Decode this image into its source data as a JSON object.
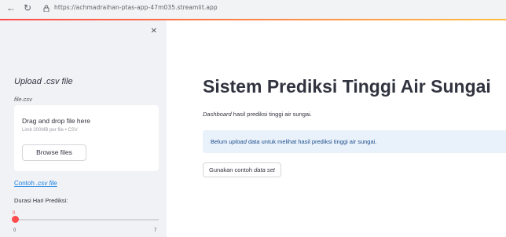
{
  "browser": {
    "url": "https://achmadraihan-ptas-app-47m035.streamlit.app"
  },
  "sidebar": {
    "close_symbol": "×",
    "upload_heading": "Upload .csv file",
    "upload_label": "file.csv",
    "uploader": {
      "title": "Drag and drop file here",
      "limit": "Limit 200MB per file • CSV",
      "browse_label": "Browse files"
    },
    "sample_link": {
      "prefix": "Contoh",
      "suffix": ".csv file"
    },
    "slider": {
      "label": "Durasi Hari Prediksi:",
      "value": "0",
      "min": "0",
      "max": "7",
      "fraction": 0
    }
  },
  "main": {
    "title": "Sistem Prediksi Tinggi Air Sungai",
    "subtitle_italic": "Dashboard",
    "subtitle_rest": " hasil prediksi tinggi air sungai.",
    "info": {
      "before": "Belum ",
      "italic": "upload",
      "after": " data untuk melihat hasil prediksi tinggi air sungai."
    },
    "sample_button": {
      "prefix": "Gunakan contoh ",
      "italic": "data set"
    }
  },
  "colors": {
    "accent": "#ff4b4b",
    "link": "#1c83e1",
    "info_bg": "#e9f1fb",
    "sidebar_bg": "#f0f2f6"
  },
  "icons": {
    "back": "arrow-left-icon",
    "reload": "reload-icon",
    "lock": "lock-icon",
    "close": "close-icon"
  }
}
